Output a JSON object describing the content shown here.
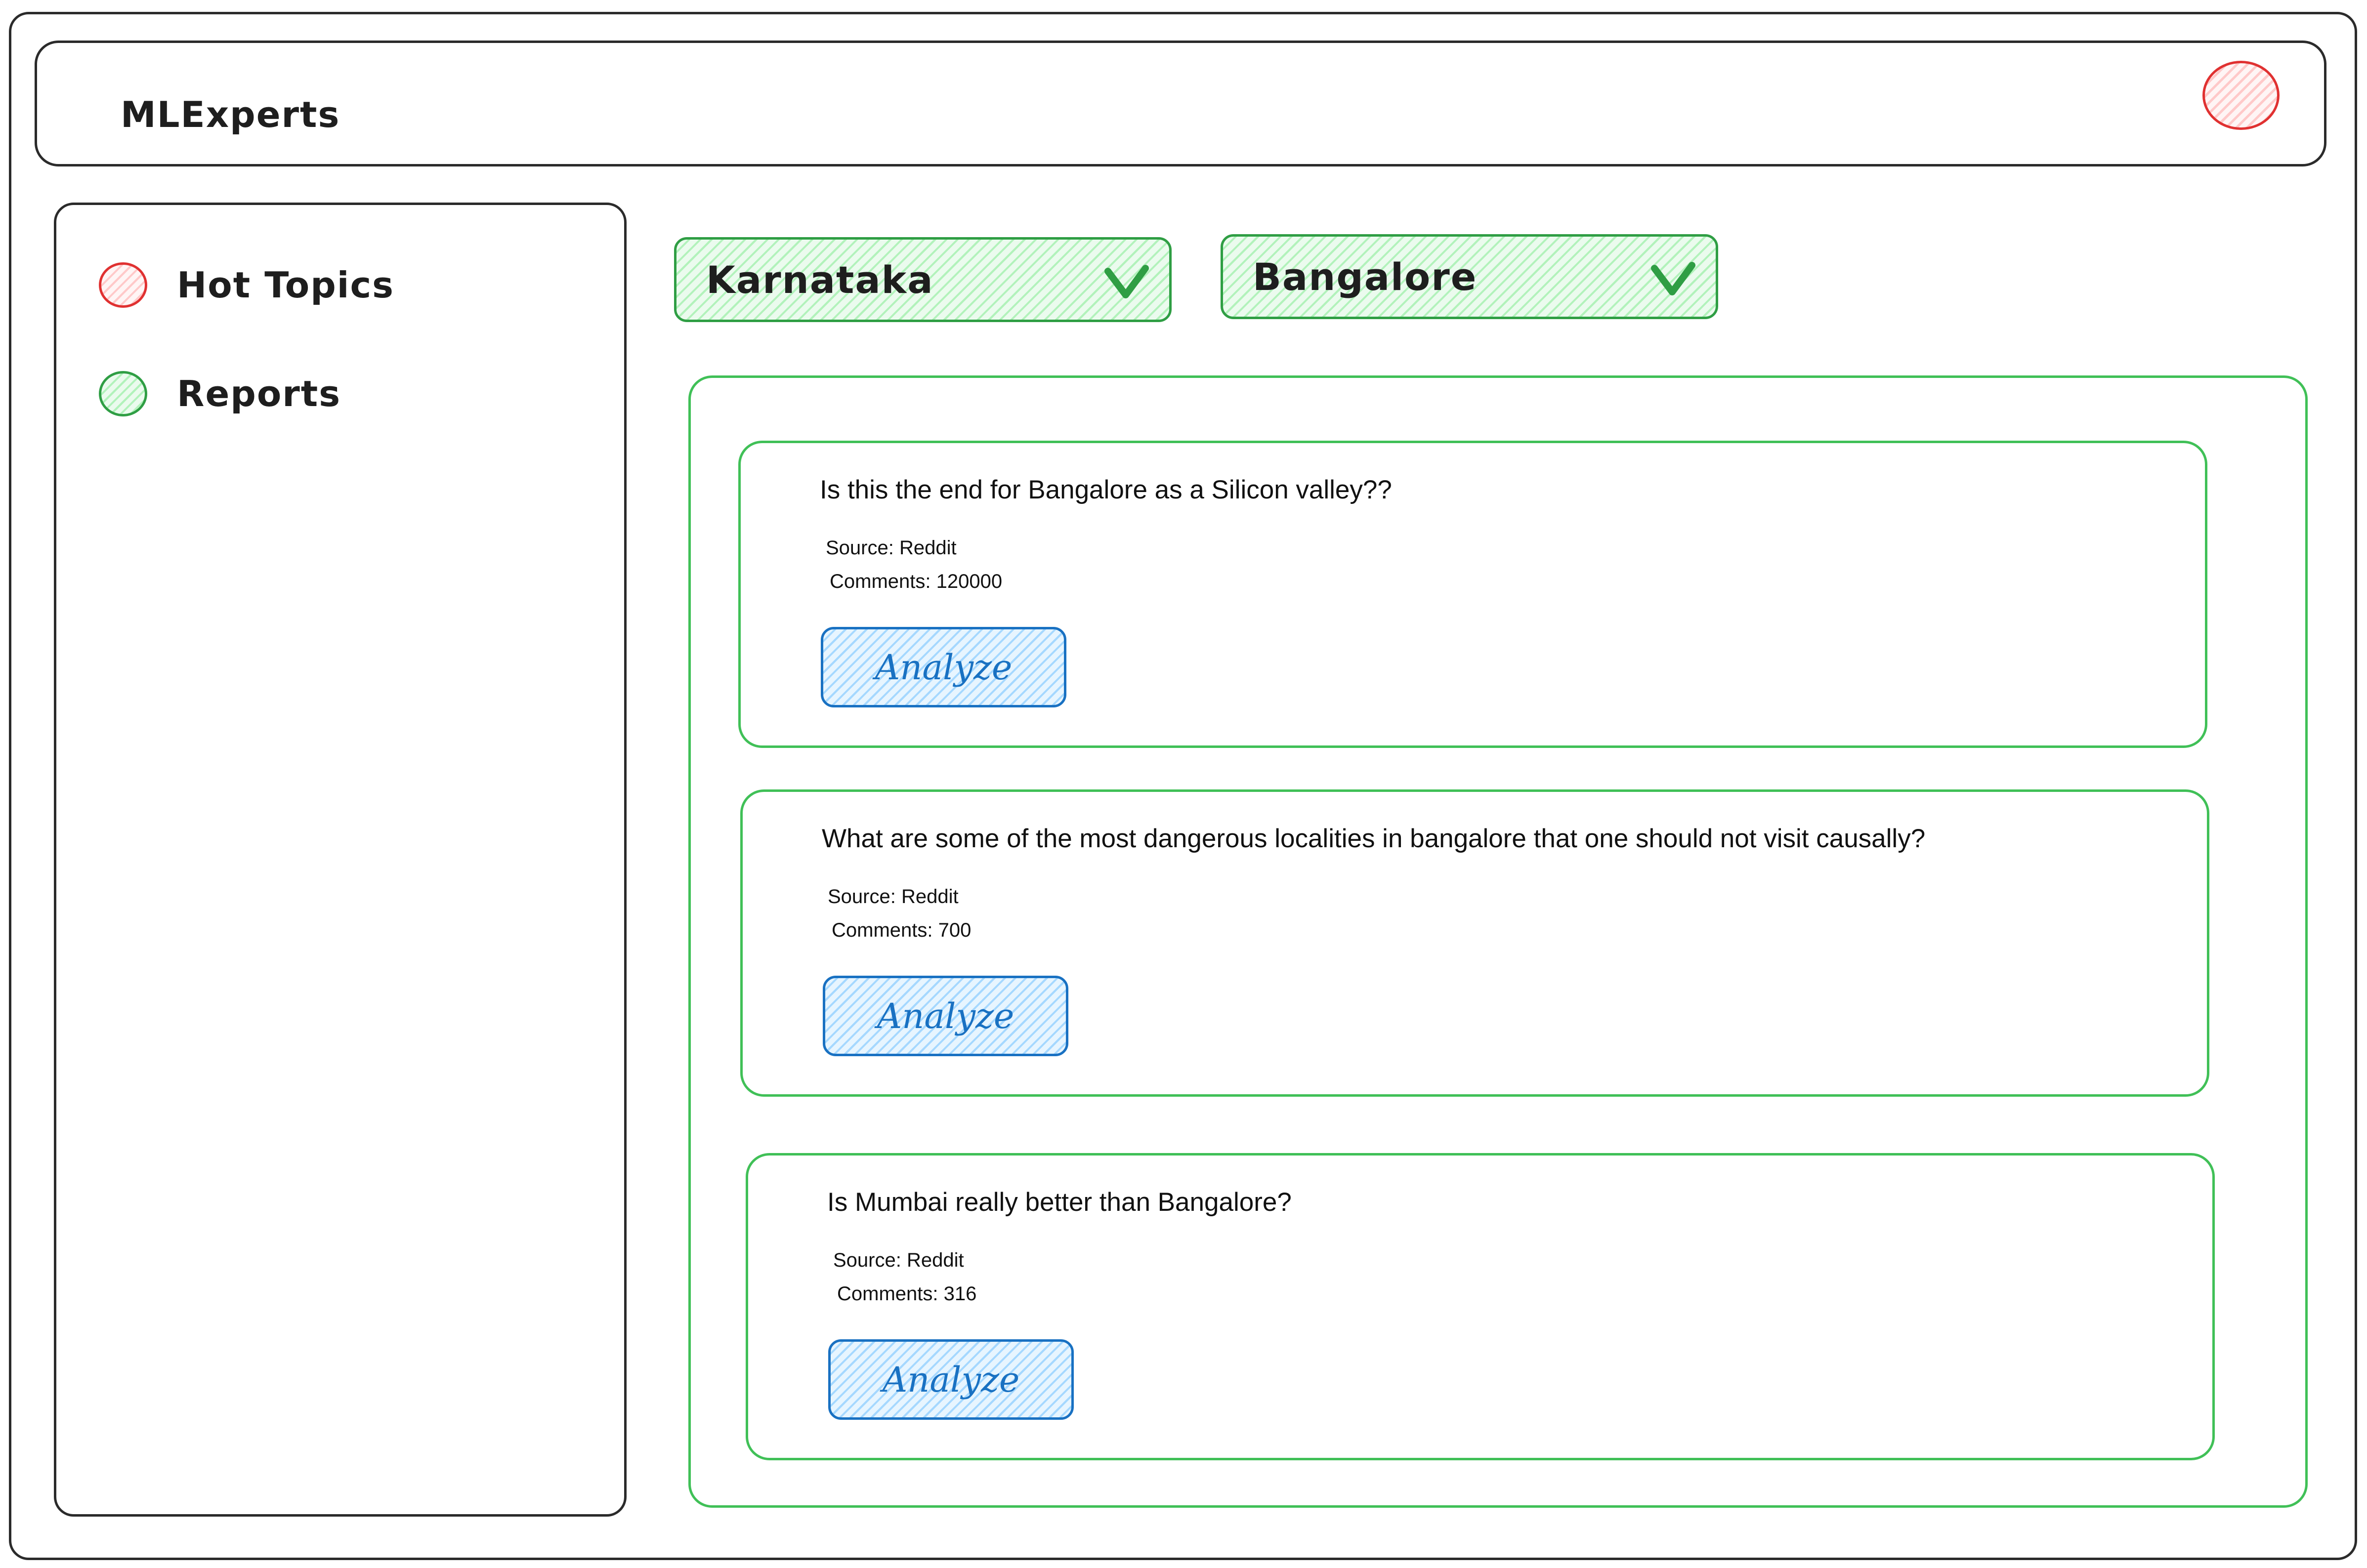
{
  "app": {
    "title": "MLExperts"
  },
  "sidebar": {
    "items": [
      {
        "label": "Hot Topics",
        "dot_color": "#e03131",
        "dot_fill": "#ffc9c9"
      },
      {
        "label": "Reports",
        "dot_color": "#2f9e44",
        "dot_fill": "#b2f2bb"
      }
    ]
  },
  "filters": {
    "state": {
      "value": "Karnataka"
    },
    "city": {
      "value": "Bangalore"
    }
  },
  "posts": [
    {
      "question": "Is this the end for Bangalore as a Silicon valley??",
      "source": "Source: Reddit",
      "comments": "Comments: 120000",
      "action": "Analyze"
    },
    {
      "question": "What are some of the most dangerous localities in bangalore that one should not visit causally?",
      "source": "Source: Reddit",
      "comments": "Comments: 700",
      "action": "Analyze"
    },
    {
      "question": "Is Mumbai really better than Bangalore?",
      "source": "Source: Reddit",
      "comments": "Comments: 316",
      "action": "Analyze"
    }
  ],
  "colors": {
    "accent_green": "#2f9e44",
    "accent_blue": "#1971c2",
    "accent_red": "#e03131"
  }
}
